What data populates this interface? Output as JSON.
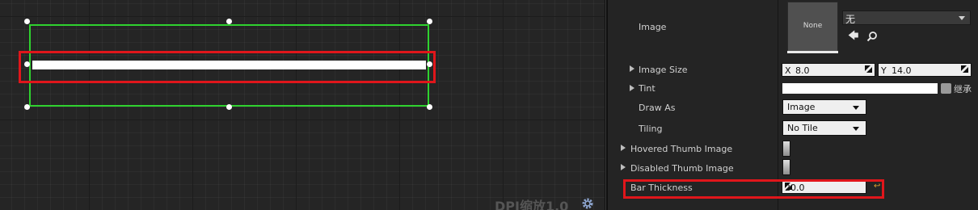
{
  "viewport": {
    "dpi_label": "DPI缩放1.0",
    "dpi_settings_icon": "gear-icon"
  },
  "details": {
    "image": {
      "label": "Image",
      "thumbnail_text": "None",
      "asset_value": "无",
      "use_icon": "arrow-left-icon",
      "browse_icon": "search-icon"
    },
    "image_size": {
      "label": "Image Size",
      "x_label": "X",
      "x_value": "8.0",
      "y_label": "Y",
      "y_value": "14.0"
    },
    "tint": {
      "label": "Tint",
      "inherit_label": "继承",
      "color": "#ffffff"
    },
    "draw_as": {
      "label": "Draw As",
      "value": "Image"
    },
    "tiling": {
      "label": "Tiling",
      "value": "No Tile"
    },
    "hovered_thumb_image": {
      "label": "Hovered Thumb Image"
    },
    "disabled_thumb_image": {
      "label": "Disabled Thumb Image"
    },
    "bar_thickness": {
      "label": "Bar Thickness",
      "value": "20.0",
      "reset_icon": "reset-to-default-icon"
    }
  },
  "colors": {
    "selection_outline": "#2fd22f",
    "highlight": "#e0161b",
    "panel_bg": "#242424",
    "viewport_bg": "#252525"
  }
}
